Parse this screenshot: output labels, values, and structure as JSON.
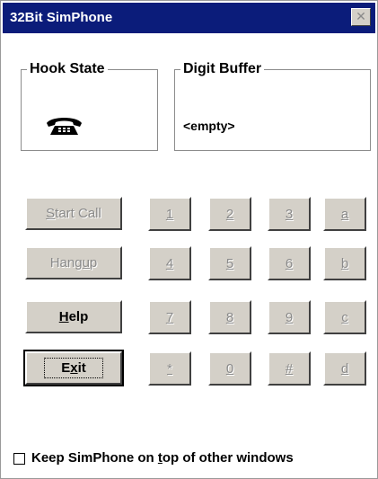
{
  "window": {
    "title": "32Bit SimPhone",
    "close_glyph": "✕"
  },
  "hook_state": {
    "label": "Hook State",
    "icon": "telephone-icon"
  },
  "digit_buffer": {
    "label": "Digit Buffer",
    "value": "<empty>"
  },
  "buttons": {
    "start_call": {
      "pre": "",
      "mnemonic": "S",
      "post": "tart Call",
      "enabled": false
    },
    "hangup": {
      "pre": "Hang",
      "mnemonic": "u",
      "post": "p",
      "enabled": false
    },
    "help": {
      "pre": "",
      "mnemonic": "H",
      "post": "elp",
      "enabled": true
    },
    "exit": {
      "pre": "E",
      "mnemonic": "x",
      "post": "it",
      "enabled": true,
      "default": true
    }
  },
  "keypad": {
    "keys": [
      [
        "1",
        "2",
        "3",
        "a"
      ],
      [
        "4",
        "5",
        "6",
        "b"
      ],
      [
        "7",
        "8",
        "9",
        "c"
      ],
      [
        "*",
        "0",
        "#",
        "d"
      ]
    ],
    "enabled": false
  },
  "options": {
    "keep_on_top": {
      "pre": "Keep SimPhone on ",
      "mnemonic": "t",
      "post": "op of other windows",
      "checked": false
    }
  },
  "colors": {
    "titlebar": "#0b1c7a",
    "button_face": "#d4d0c8",
    "disabled_text": "#8a8a8a"
  }
}
